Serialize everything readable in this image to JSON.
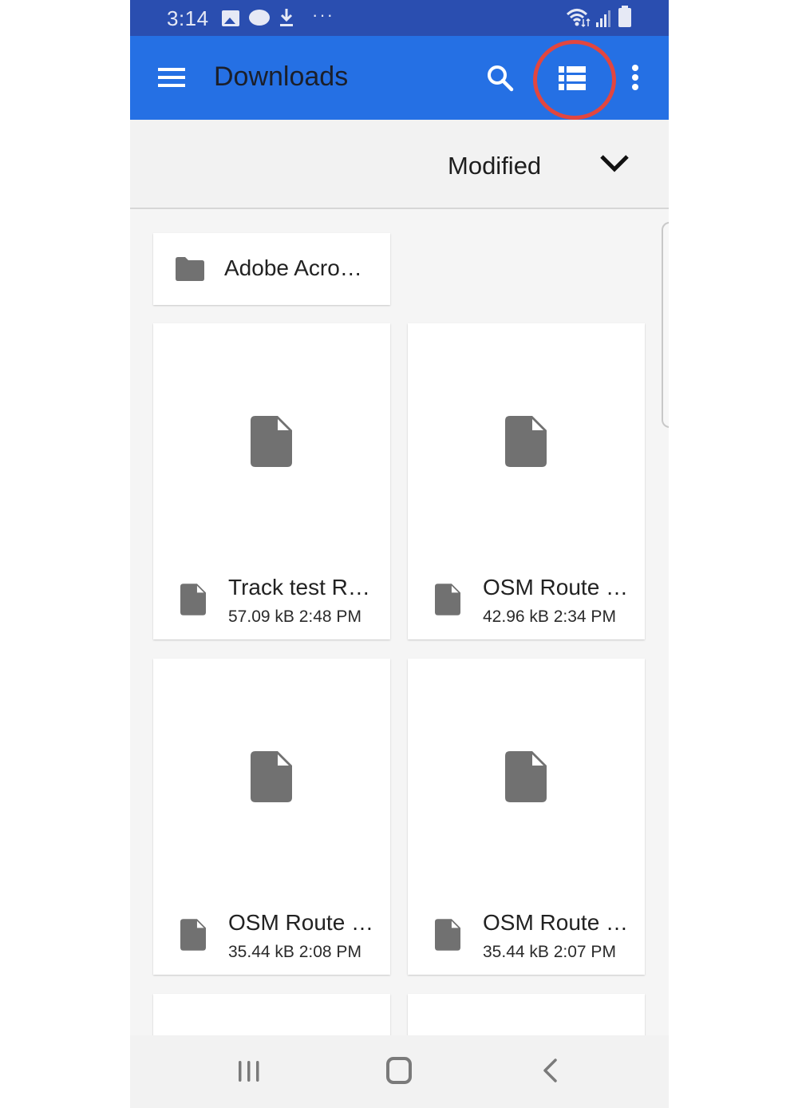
{
  "status_bar": {
    "time": "3:14",
    "icons": [
      "gallery-icon",
      "cloud-icon",
      "download-icon",
      "more-notifications-icon",
      "wifi-icon",
      "signal-icon",
      "battery-icon"
    ],
    "more_glyph": "···"
  },
  "app_bar": {
    "title": "Downloads",
    "color": "#2570e4",
    "actions": [
      "menu-icon",
      "search-icon",
      "list-view-icon",
      "more-vert-icon"
    ],
    "highlighted_action": "list-view-icon",
    "highlight_color": "#e2463f"
  },
  "sort": {
    "label": "Modified",
    "icon": "chevron-down-icon"
  },
  "folders": [
    {
      "name": "Adobe Acro…",
      "icon": "folder-icon"
    }
  ],
  "files": [
    {
      "name": "Track test R…",
      "size": "57.09 kB",
      "time": "2:48 PM",
      "meta": "57.09 kB 2:48 PM"
    },
    {
      "name": "OSM Route …",
      "size": "42.96 kB",
      "time": "2:34 PM",
      "meta": "42.96 kB 2:34 PM"
    },
    {
      "name": "OSM Route …",
      "size": "35.44 kB",
      "time": "2:08 PM",
      "meta": "35.44 kB 2:08 PM"
    },
    {
      "name": "OSM Route …",
      "size": "35.44 kB",
      "time": "2:07 PM",
      "meta": "35.44 kB 2:07 PM"
    }
  ],
  "nav_bar": {
    "buttons": [
      "recents-icon",
      "home-icon",
      "back-icon"
    ]
  }
}
